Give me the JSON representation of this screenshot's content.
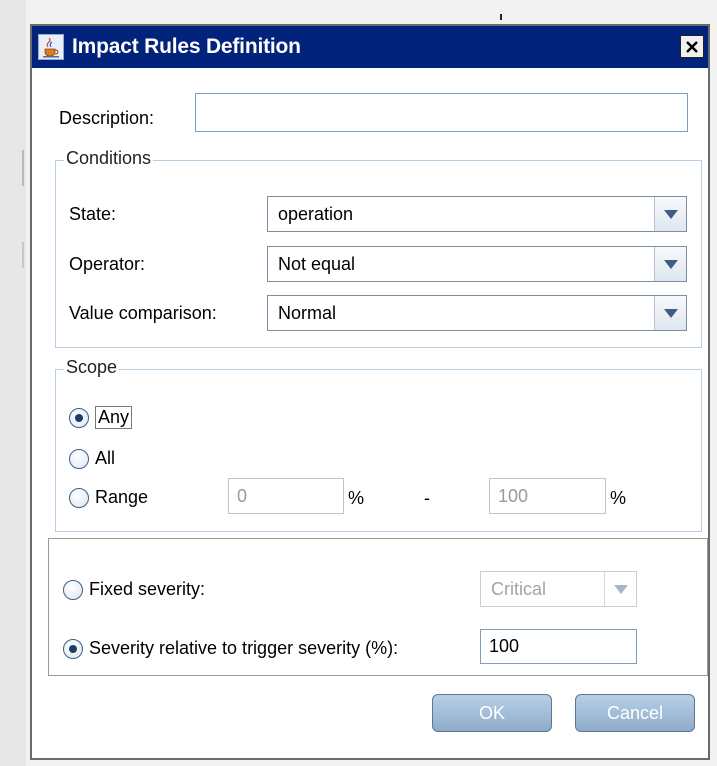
{
  "window": {
    "title": "Impact Rules Definition",
    "close_symbol": "✕"
  },
  "description": {
    "label": "Description:",
    "value": ""
  },
  "conditions": {
    "title": "Conditions",
    "state_label": "State:",
    "state_value": "operation",
    "operator_label": "Operator:",
    "operator_value": "Not equal",
    "value_comparison_label": "Value comparison:",
    "value_comparison_value": "Normal"
  },
  "scope": {
    "title": "Scope",
    "any_label": "Any",
    "all_label": "All",
    "range_label": "Range",
    "range_from": "0",
    "range_to": "100",
    "percent_symbol": "%",
    "dash": "-",
    "selected": "Any"
  },
  "severity": {
    "fixed_label": "Fixed severity:",
    "fixed_value": "Critical",
    "relative_label": "Severity relative to trigger severity (%):",
    "relative_value": "100",
    "selected": "relative"
  },
  "buttons": {
    "ok": "OK",
    "cancel": "Cancel"
  },
  "icons": {
    "title": "java-cup-icon",
    "close": "close-icon",
    "dropdown": "chevron-down-icon"
  },
  "colors": {
    "titlebar": "#02237c",
    "group_border": "#b8cfe5",
    "button_top": "#b8cfe6",
    "button_bottom": "#8eacc9"
  }
}
